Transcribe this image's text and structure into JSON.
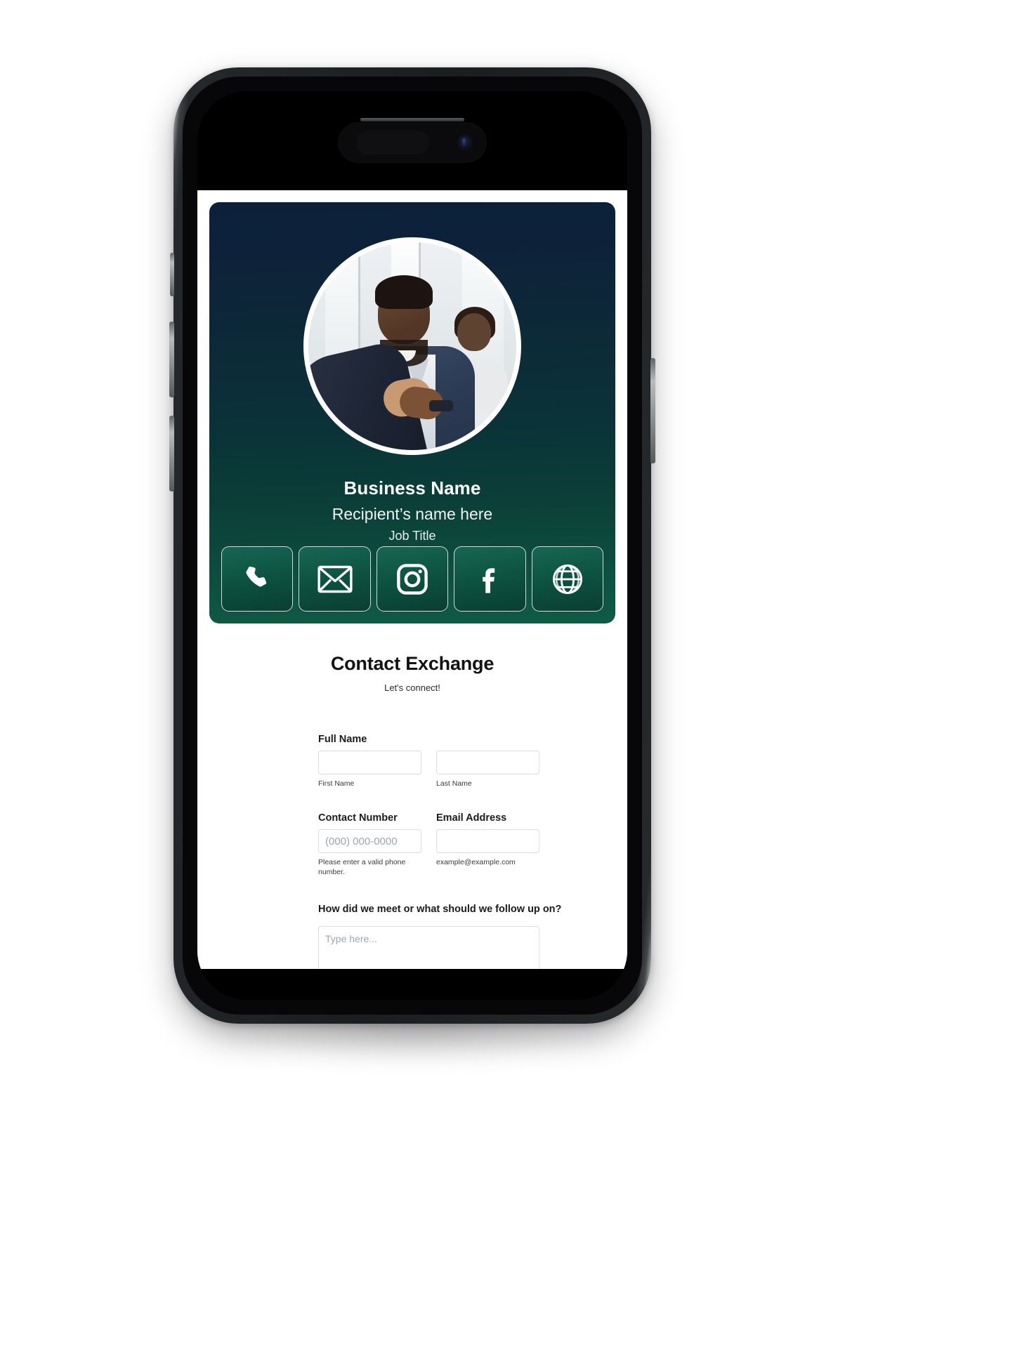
{
  "card": {
    "business_name": "Business Name",
    "recipient_name": "Recipient’s name here",
    "job_title": "Job Title",
    "gradient_top": "#0c203a",
    "gradient_bottom": "#0f5c46",
    "social_buttons": [
      {
        "icon": "phone-icon",
        "label": "Phone"
      },
      {
        "icon": "email-icon",
        "label": "Email"
      },
      {
        "icon": "instagram-icon",
        "label": "Instagram"
      },
      {
        "icon": "facebook-icon",
        "label": "Facebook"
      },
      {
        "icon": "globe-icon",
        "label": "Website"
      }
    ]
  },
  "form": {
    "title": "Contact Exchange",
    "subtitle": "Let's connect!",
    "full_name": {
      "label": "Full Name",
      "first": {
        "value": "",
        "placeholder": "",
        "hint": "First Name"
      },
      "last": {
        "value": "",
        "placeholder": "",
        "hint": "Last Name"
      }
    },
    "contact_number": {
      "label": "Contact Number",
      "value": "",
      "placeholder": "(000) 000-0000",
      "hint": "Please enter a valid phone number."
    },
    "email_address": {
      "label": "Email Address",
      "value": "",
      "placeholder": "",
      "hint": "example@example.com"
    },
    "follow_up": {
      "label": "How did we meet or what should we follow up on?",
      "value": "",
      "placeholder": "Type here..."
    }
  }
}
